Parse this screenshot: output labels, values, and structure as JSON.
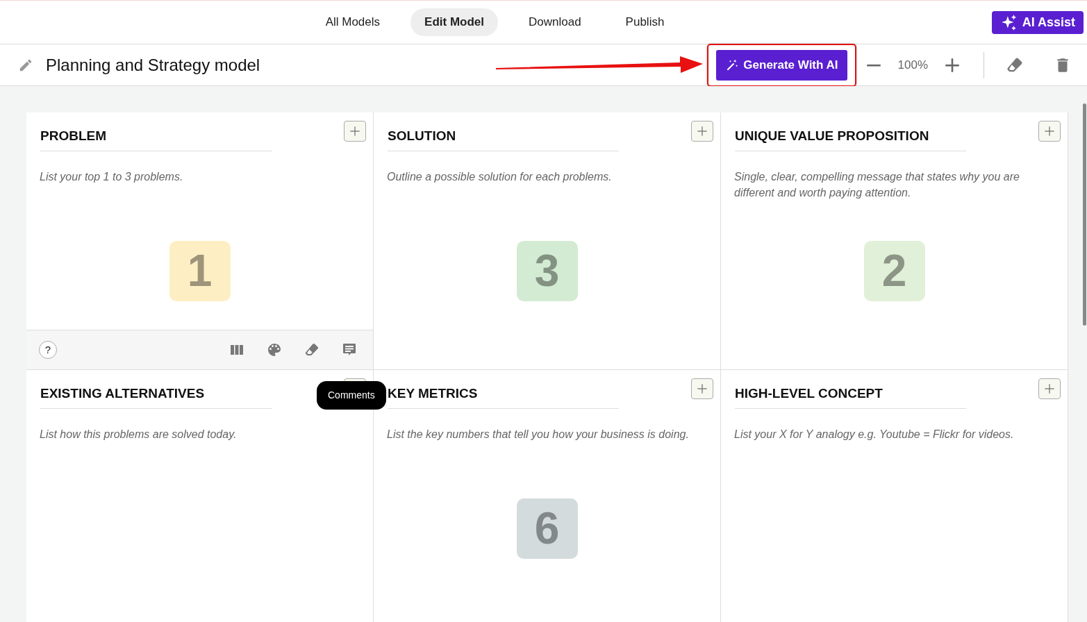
{
  "nav": {
    "tabs": [
      {
        "label": "All Models",
        "selected": false
      },
      {
        "label": "Edit Model",
        "selected": true
      },
      {
        "label": "Download",
        "selected": false
      },
      {
        "label": "Publish",
        "selected": false
      }
    ],
    "assist_button": "AI Assist"
  },
  "toolbar": {
    "title": "Planning and Strategy model",
    "generate_button": "Generate With AI",
    "zoom": "100%"
  },
  "cells": [
    {
      "title": "PROBLEM",
      "description": "List your top 1 to 3 problems.",
      "number": "1",
      "color": "#fdefc3",
      "footer": {
        "help": "?",
        "tooltip": "Comments"
      }
    },
    {
      "title": "SOLUTION",
      "description": "Outline a possible solution for each problems.",
      "number": "3",
      "color": "#d3ebd3"
    },
    {
      "title": "UNIQUE VALUE PROPOSITION",
      "description": "Single, clear, compelling message that states why you are different and worth paying attention.",
      "number": "2",
      "color": "#e1f0d8"
    },
    {
      "title": "EXISTING ALTERNATIVES",
      "description": "List how this problems are solved today.",
      "add_icon_covered": true
    },
    {
      "title": "KEY METRICS",
      "description": "List the key numbers that tell you how your business is doing.",
      "number": "6",
      "color": "#d4dbdc"
    },
    {
      "title": "HIGH-LEVEL CONCEPT",
      "description": "List your X for Y analogy e.g. Youtube = Flickr for videos."
    }
  ]
}
